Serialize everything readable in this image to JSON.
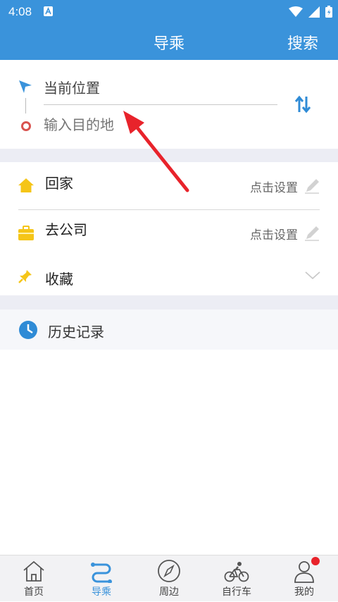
{
  "status_bar": {
    "time": "4:08"
  },
  "header": {
    "title": "导乘",
    "search_label": "搜索"
  },
  "route": {
    "origin": "当前位置",
    "destination_placeholder": "输入目的地"
  },
  "shortcuts": {
    "home": {
      "label": "回家",
      "action": "点击设置"
    },
    "work": {
      "label": "去公司",
      "action": "点击设置"
    },
    "favorites": {
      "label": "收藏"
    }
  },
  "history": {
    "label": "历史记录"
  },
  "bottom_nav": [
    {
      "label": "首页",
      "icon": "home-outline-icon",
      "active": false
    },
    {
      "label": "导乘",
      "icon": "route-icon",
      "active": true
    },
    {
      "label": "周边",
      "icon": "compass-icon",
      "active": false
    },
    {
      "label": "自行车",
      "icon": "bicycle-icon",
      "active": false
    },
    {
      "label": "我的",
      "icon": "profile-icon",
      "active": false,
      "badge": true
    }
  ],
  "colors": {
    "primary": "#3a93db",
    "section_gap": "#ecedf4",
    "home_icon": "#f5c518",
    "work_icon": "#f5c518",
    "favorite_icon": "#f5c518",
    "badge": "#e8232b",
    "annotation_arrow": "#e8232b"
  }
}
